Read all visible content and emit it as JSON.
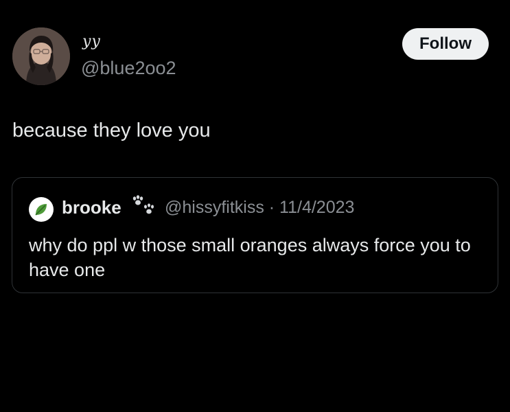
{
  "tweet": {
    "author": {
      "display_name": "yy",
      "handle": "@blue2oo2",
      "avatar_icon": "profile-photo"
    },
    "follow_label": "Follow",
    "text": "because they love you",
    "quote": {
      "avatar_icon": "leaf-icon",
      "display_name": "brooke",
      "name_icon": "paw-prints-icon",
      "handle_and_date": "@hissyfitkiss · 11/4/2023",
      "text": "why do ppl w those small oranges always force you to have one"
    }
  },
  "colors": {
    "background": "#000000",
    "primary_text": "#e7e9ea",
    "secondary_text": "#8b8f94",
    "border": "#2f3336",
    "follow_button_bg": "#eff1f2"
  }
}
